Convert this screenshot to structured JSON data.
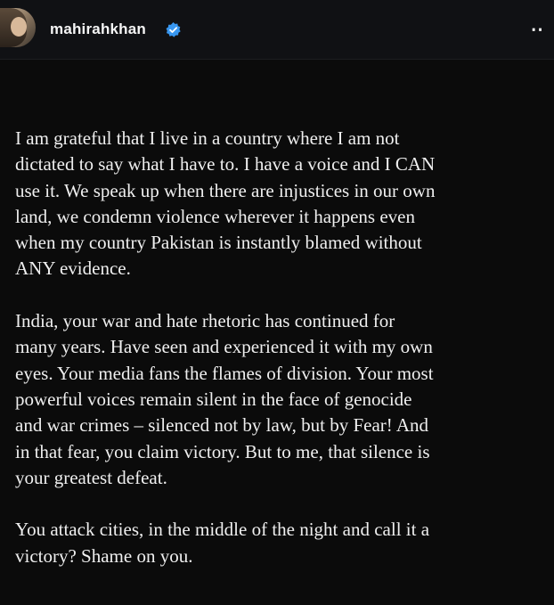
{
  "header": {
    "username": "mahirahkhan",
    "verified_icon": "verified-badge-icon",
    "more_icon": "more-options-icon",
    "more_glyph": "⋅⋅",
    "verified_color": "#3897f0"
  },
  "post": {
    "paragraphs": [
      "I am grateful that I live in a country where I am not\ndictated to say what I have to. I have a voice and I CAN\nuse it. We speak up when there are injustices in our own\nland, we condemn violence wherever it happens even\nwhen my country Pakistan is instantly blamed without\nANY evidence.",
      "India, your war and hate rhetoric has continued for\nmany years. Have seen and experienced it with my own\neyes. Your media fans the flames of division. Your most\npowerful voices remain silent in the face of genocide\nand war crimes – silenced not by law, but by Fear! And\nin that fear, you claim victory. But to me, that silence is\nyour greatest defeat.",
      "You attack cities, in the middle of the night and call it a\nvictory? Shame on you."
    ]
  }
}
